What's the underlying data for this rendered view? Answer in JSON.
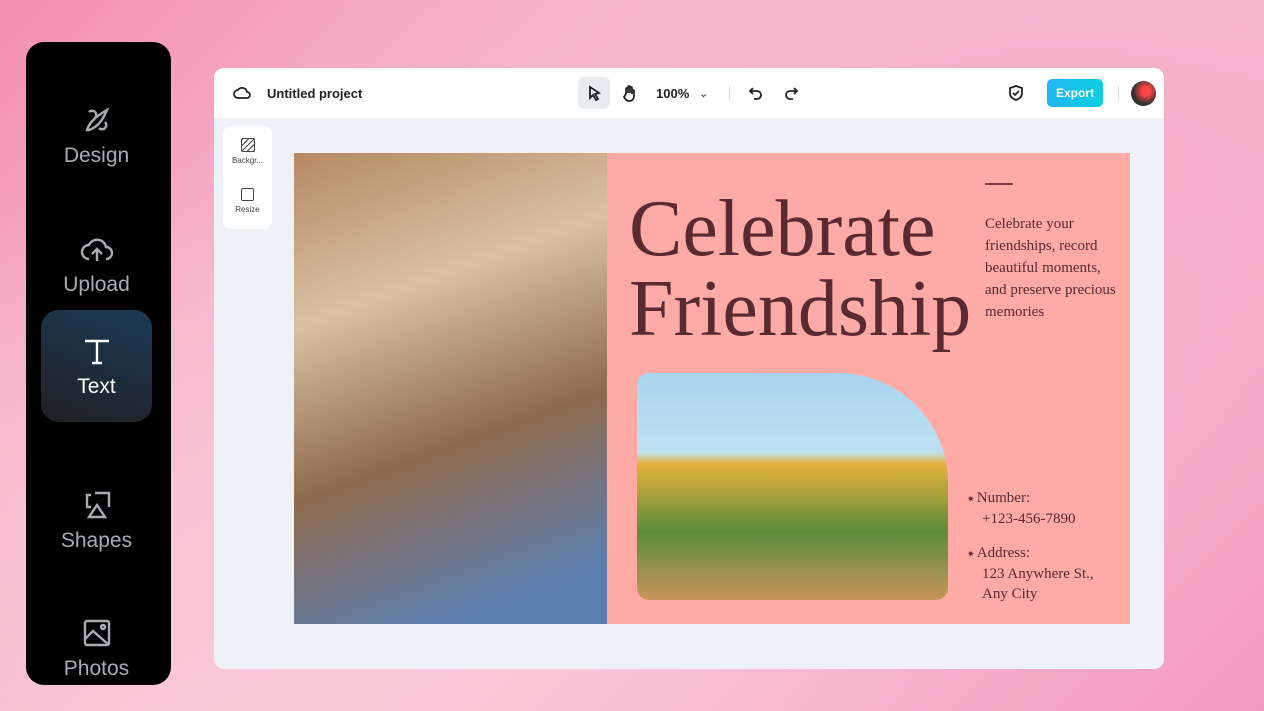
{
  "sidebar": {
    "items": [
      {
        "label": "Design",
        "icon": "rocket-icon"
      },
      {
        "label": "Upload",
        "icon": "cloud-upload-icon"
      },
      {
        "label": "Text",
        "icon": "text-icon",
        "active": true
      },
      {
        "label": "Shapes",
        "icon": "shapes-icon"
      },
      {
        "label": "Photos",
        "icon": "image-icon"
      }
    ]
  },
  "topbar": {
    "project": "Untitled project",
    "zoom": "100%",
    "export": "Export"
  },
  "tools": {
    "background": "Backgr...",
    "resize": "Resize"
  },
  "design": {
    "title1": "Celebrate",
    "title2": "Friendship",
    "description": "Celebrate your friendships, record beautiful moments, and preserve precious memories",
    "number_label": "Number:",
    "number": "+123-456-7890",
    "address_label": "Address:",
    "address1": "123 Anywhere St.,",
    "address2": "Any City"
  }
}
